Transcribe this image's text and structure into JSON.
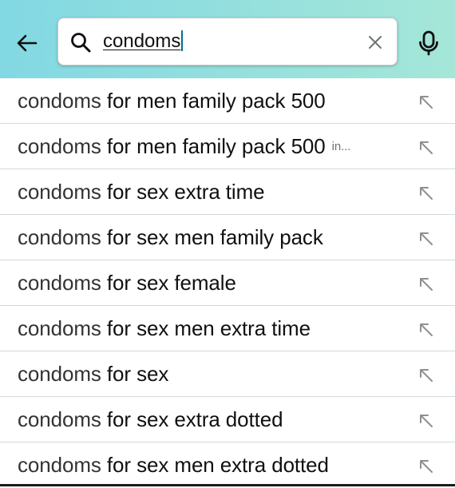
{
  "header": {
    "gradient_start": "#82d8e3",
    "gradient_end": "#a5e6d8",
    "back_icon": "arrow-left-icon",
    "mic_icon": "microphone-icon"
  },
  "search": {
    "value": "condoms",
    "search_icon": "search-icon",
    "clear_icon": "close-icon"
  },
  "suggestions": [
    {
      "prefix": "condoms",
      "suffix": " for men family pack 500",
      "department": ""
    },
    {
      "prefix": "condoms",
      "suffix": " for men family pack 500",
      "department": "in..."
    },
    {
      "prefix": "condoms",
      "suffix": " for sex extra time",
      "department": ""
    },
    {
      "prefix": "condoms",
      "suffix": " for sex men family pack",
      "department": ""
    },
    {
      "prefix": "condoms",
      "suffix": " for sex female",
      "department": ""
    },
    {
      "prefix": "condoms",
      "suffix": " for sex men extra time",
      "department": ""
    },
    {
      "prefix": "condoms",
      "suffix": " for sex",
      "department": ""
    },
    {
      "prefix": "condoms",
      "suffix": " for sex extra dotted",
      "department": ""
    },
    {
      "prefix": "condoms",
      "suffix": " for sex men extra dotted",
      "department": ""
    }
  ],
  "suggestion_fill_icon": "arrow-up-left-icon"
}
